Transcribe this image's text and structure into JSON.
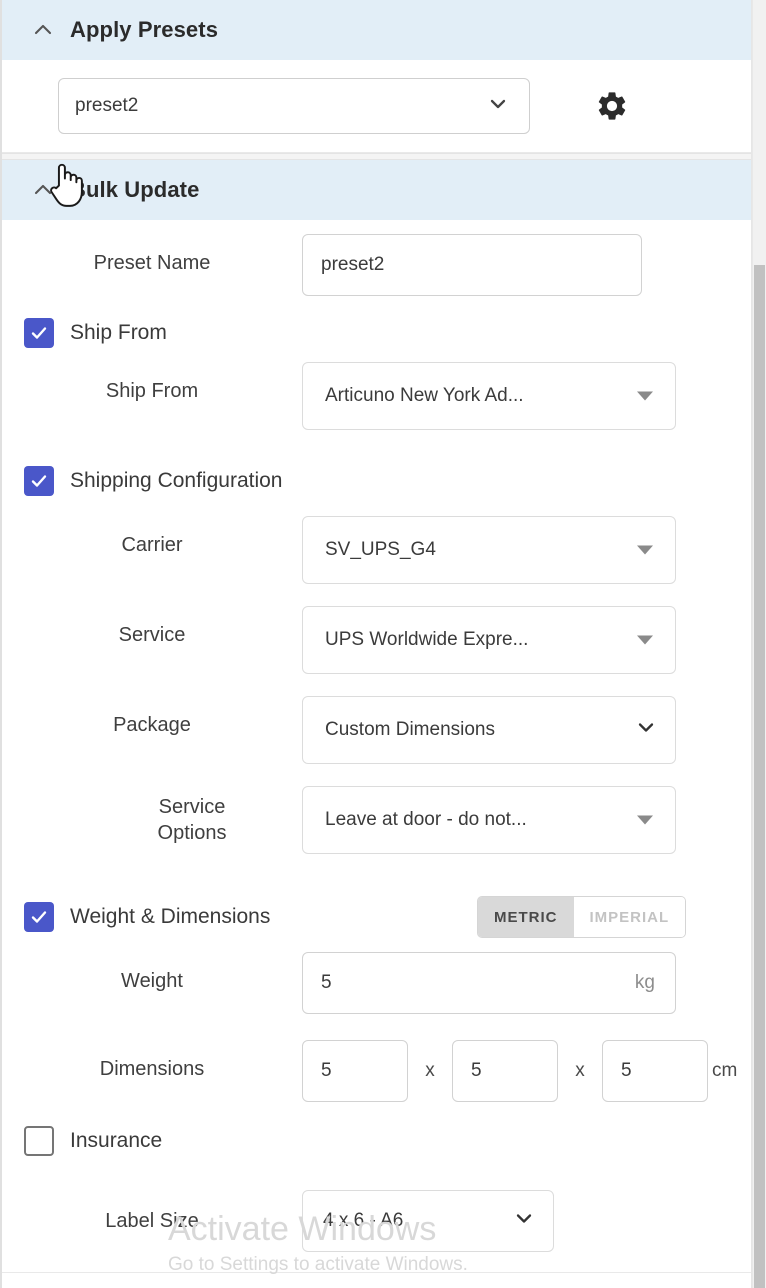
{
  "apply_presets": {
    "title": "Apply Presets",
    "collapse_icon": "chevron-up-icon",
    "preset_value": "preset2",
    "preset_dropdown_icon": "chevron-down-icon",
    "settings_icon": "gear-icon"
  },
  "bulk_update": {
    "title": "Bulk Update",
    "collapse_icon": "chevron-up-icon",
    "preset_name": {
      "label": "Preset Name",
      "value": "preset2"
    },
    "ship_from_section": {
      "label": "Ship From",
      "checked": true,
      "field_label": "Ship From",
      "value": "Articuno New York Ad...",
      "dropdown_icon": "triangle-down-icon"
    },
    "shipping_configuration": {
      "label": "Shipping Configuration",
      "checked": true,
      "fields": [
        {
          "label": "Carrier",
          "value": "SV_UPS_G4",
          "icon": "triangle-down-icon"
        },
        {
          "label": "Service",
          "value": "UPS Worldwide Expre...",
          "icon": "triangle-down-icon"
        },
        {
          "label": "Package",
          "value": "Custom Dimensions",
          "icon": "chevron-down-icon"
        },
        {
          "label": "Service Options",
          "value": "Leave at door - do not...",
          "icon": "triangle-down-icon"
        }
      ]
    },
    "weight_dimensions": {
      "label": "Weight & Dimensions",
      "checked": true,
      "unit_toggle": {
        "metric": "METRIC",
        "imperial": "IMPERIAL",
        "selected": "METRIC"
      },
      "weight": {
        "label": "Weight",
        "value": "5",
        "unit": "kg"
      },
      "dimensions": {
        "label": "Dimensions",
        "length": "5",
        "width": "5",
        "height": "5",
        "separator": "x",
        "unit": "cm"
      }
    },
    "insurance": {
      "label": "Insurance",
      "checked": false
    },
    "label_size": {
      "label": "Label Size",
      "value": "4 x 6 - A6",
      "dropdown_icon": "chevron-down-icon"
    }
  },
  "watermark": {
    "line1": "Activate Windows",
    "line2": "Go to Settings to activate Windows."
  },
  "colors": {
    "header_bg": "#e2eef7",
    "checkbox_checked": "#4a57c9",
    "toggle_active_bg": "#d9d9d9",
    "scrollbar_thumb": "#c1c1c1"
  }
}
